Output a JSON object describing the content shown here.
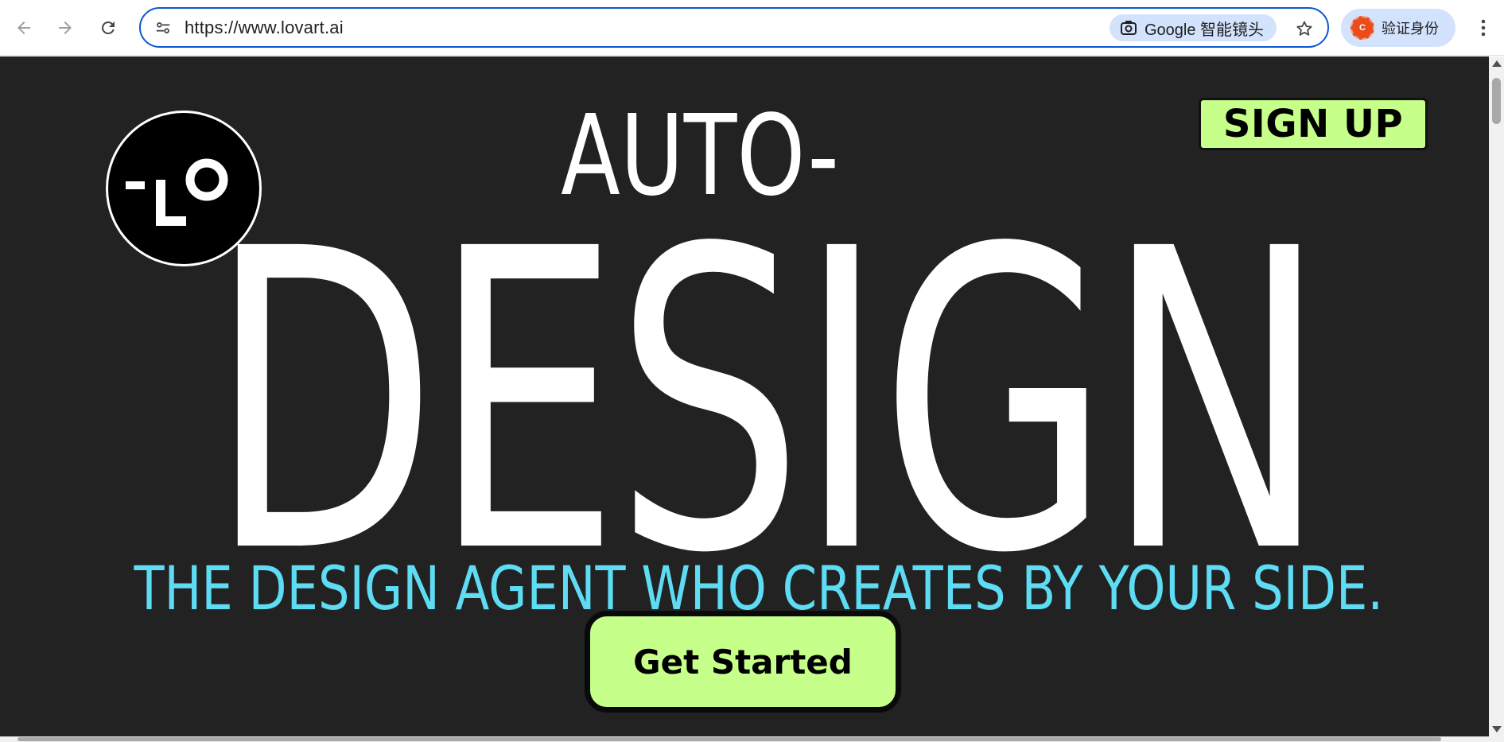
{
  "browser": {
    "url": "https://www.lovart.ai",
    "lens_label": "Google 智能镜头",
    "profile_label": "验证身份",
    "profile_initial": "C"
  },
  "hero": {
    "eyebrow": "AUTO-",
    "headline": "DESIGN",
    "tagline": "THE DESIGN AGENT WHO CREATES BY YOUR SIDE.",
    "cta_label": "Get Started",
    "signup_label": "SIGN UP"
  },
  "colors": {
    "page_background": "#222222",
    "accent_green": "#c6ff8a",
    "tagline_cyan": "#5ddcf3",
    "omnibox_focus": "#0b57d0"
  },
  "icons": {
    "back": "arrow-left-icon",
    "forward": "arrow-right-icon",
    "reload": "reload-icon",
    "site_info": "tune-icon",
    "lens": "camera-lens-icon",
    "bookmark": "star-icon",
    "menu": "three-dot-menu-icon",
    "logo": "lovart-logo"
  }
}
